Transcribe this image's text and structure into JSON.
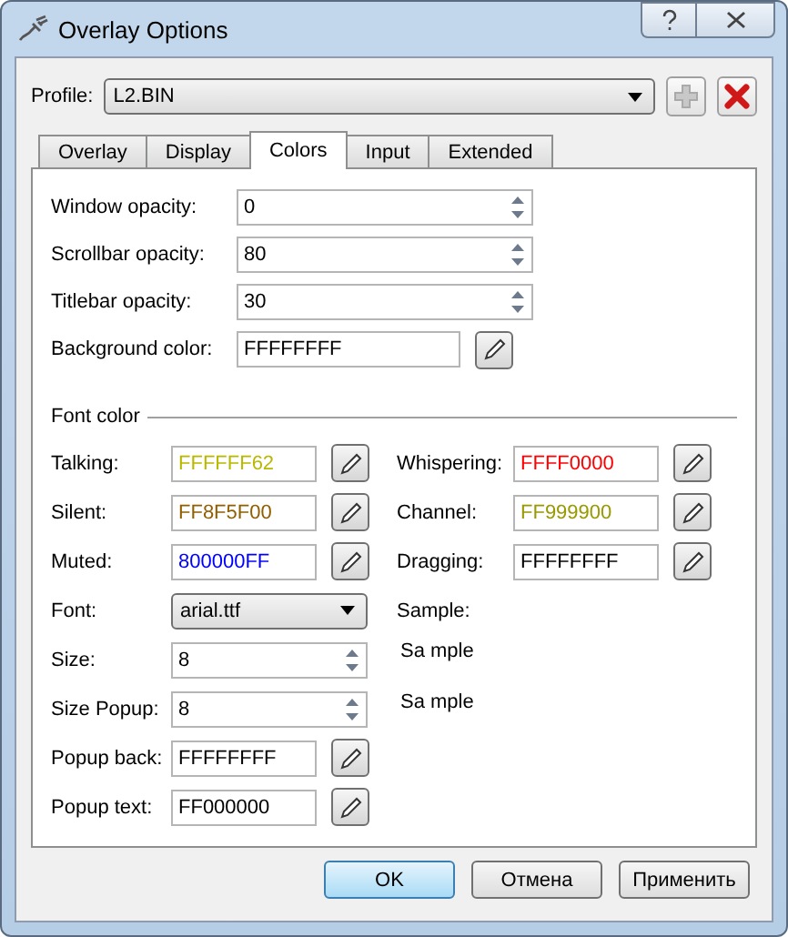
{
  "window": {
    "title": "Overlay Options"
  },
  "profile": {
    "label": "Profile:",
    "value": "L2.BIN"
  },
  "tabs": [
    {
      "label": "Overlay",
      "selected": false
    },
    {
      "label": "Display",
      "selected": false
    },
    {
      "label": "Colors",
      "selected": true
    },
    {
      "label": "Input",
      "selected": false
    },
    {
      "label": "Extended",
      "selected": false
    }
  ],
  "top_fields": [
    {
      "kind": "spin",
      "label": "Window opacity:",
      "value": "0"
    },
    {
      "kind": "spin",
      "label": "Scrollbar opacity:",
      "value": "80"
    },
    {
      "kind": "spin",
      "label": "Titlebar opacity:",
      "value": "30"
    },
    {
      "kind": "color",
      "label": "Background color:",
      "value": "FFFFFFFF",
      "color": "#000000"
    }
  ],
  "font_color": {
    "title": "Font color",
    "left": [
      {
        "kind": "color",
        "label": "Talking:",
        "value": "FFFFFF62",
        "color": "#b8b800"
      },
      {
        "kind": "color",
        "label": "Silent:",
        "value": "FF8F5F00",
        "color": "#8f5f00"
      },
      {
        "kind": "color",
        "label": "Muted:",
        "value": "800000FF",
        "color": "#0000ff"
      },
      {
        "kind": "dropdown",
        "label": "Font:",
        "value": "arial.ttf"
      },
      {
        "kind": "spin",
        "label": "Size:",
        "value": "8"
      },
      {
        "kind": "spin",
        "label": "Size Popup:",
        "value": "8"
      },
      {
        "kind": "color",
        "label": "Popup back:",
        "value": "FFFFFFFF",
        "color": "#000000"
      },
      {
        "kind": "color",
        "label": "Popup text:",
        "value": "FF000000",
        "color": "#000000"
      }
    ],
    "right": [
      {
        "kind": "color",
        "label": "Whispering:",
        "value": "FFFF0000",
        "color": "#ff0000"
      },
      {
        "kind": "color",
        "label": "Channel:",
        "value": "FF999900",
        "color": "#999900"
      },
      {
        "kind": "color",
        "label": "Dragging:",
        "value": "FFFFFFFF",
        "color": "#000000"
      },
      {
        "kind": "heading",
        "label": "Sample:"
      },
      {
        "kind": "sample",
        "label": "Sa mple"
      },
      {
        "kind": "sample",
        "label": "Sa mple"
      }
    ]
  },
  "buttons": [
    {
      "label": "OK",
      "default": true
    },
    {
      "label": "Отмена",
      "default": false
    },
    {
      "label": "Применить",
      "default": false
    }
  ]
}
